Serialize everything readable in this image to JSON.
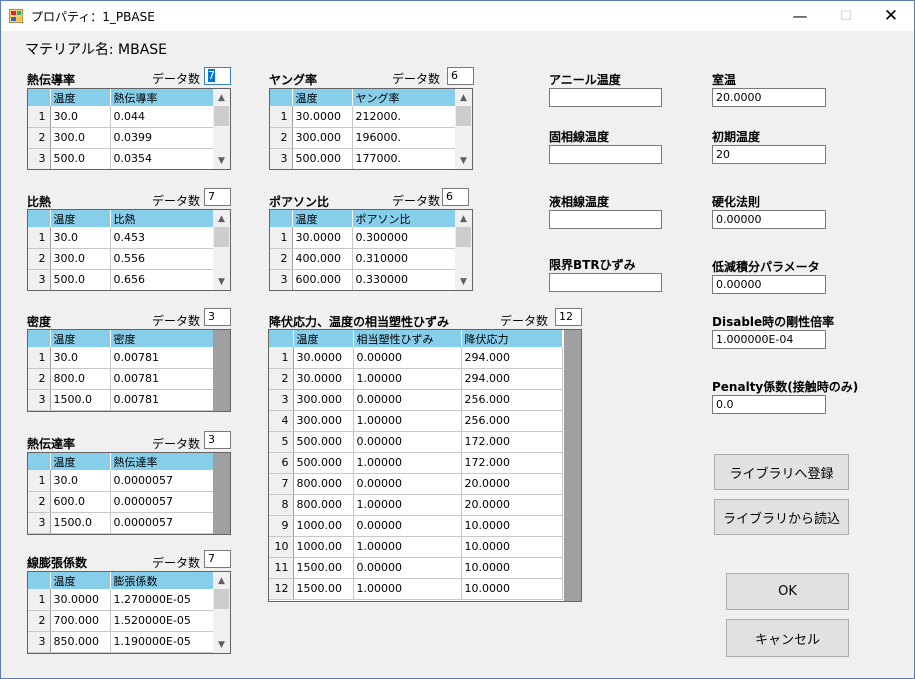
{
  "window": {
    "title": "プロパティ：1_PBASE",
    "min": "—",
    "max": "☐",
    "close": "✕"
  },
  "material_label": "マテリアル名:  MBASE",
  "count_label": "データ数",
  "conductivity": {
    "title": "熱伝導率",
    "count": "7",
    "headers": [
      "",
      "温度",
      "熱伝導率"
    ],
    "rows": [
      [
        "1",
        "30.0",
        "0.044"
      ],
      [
        "2",
        "300.0",
        "0.0399"
      ],
      [
        "3",
        "500.0",
        "0.0354"
      ]
    ]
  },
  "specific_heat": {
    "title": "比熱",
    "count": "7",
    "headers": [
      "",
      "温度",
      "比熱"
    ],
    "rows": [
      [
        "1",
        "30.0",
        "0.453"
      ],
      [
        "2",
        "300.0",
        "0.556"
      ],
      [
        "3",
        "500.0",
        "0.656"
      ]
    ]
  },
  "density": {
    "title": "密度",
    "count": "3",
    "headers": [
      "",
      "温度",
      "密度"
    ],
    "rows": [
      [
        "1",
        "30.0",
        "0.00781"
      ],
      [
        "2",
        "800.0",
        "0.00781"
      ],
      [
        "3",
        "1500.0",
        "0.00781"
      ]
    ]
  },
  "heat_transfer": {
    "title": "熱伝達率",
    "count": "3",
    "headers": [
      "",
      "温度",
      "熱伝達率"
    ],
    "rows": [
      [
        "1",
        "30.0",
        "0.0000057"
      ],
      [
        "2",
        "600.0",
        "0.0000057"
      ],
      [
        "3",
        "1500.0",
        "0.0000057"
      ]
    ]
  },
  "expansion": {
    "title": "線膨張係数",
    "count": "7",
    "headers": [
      "",
      "温度",
      "膨張係数"
    ],
    "rows": [
      [
        "1",
        "30.0000",
        "1.270000E-05"
      ],
      [
        "2",
        "700.000",
        "1.520000E-05"
      ],
      [
        "3",
        "850.000",
        "1.190000E-05"
      ]
    ]
  },
  "young": {
    "title": "ヤング率",
    "count": "6",
    "headers": [
      "",
      "温度",
      "ヤング率"
    ],
    "rows": [
      [
        "1",
        "30.0000",
        "212000."
      ],
      [
        "2",
        "300.000",
        "196000."
      ],
      [
        "3",
        "500.000",
        "177000."
      ]
    ]
  },
  "poisson": {
    "title": "ポアソン比",
    "count": "6",
    "headers": [
      "",
      "温度",
      "ポアソン比"
    ],
    "rows": [
      [
        "1",
        "30.0000",
        "0.300000"
      ],
      [
        "2",
        "400.000",
        "0.310000"
      ],
      [
        "3",
        "600.000",
        "0.330000"
      ]
    ]
  },
  "yield": {
    "title": "降伏応力、温度の相当塑性ひずみ",
    "count": "12",
    "headers": [
      "",
      "温度",
      "相当塑性ひずみ",
      "降伏応力"
    ],
    "rows": [
      [
        "1",
        "30.0000",
        "0.00000",
        "294.000"
      ],
      [
        "2",
        "30.0000",
        "1.00000",
        "294.000"
      ],
      [
        "3",
        "300.000",
        "0.00000",
        "256.000"
      ],
      [
        "4",
        "300.000",
        "1.00000",
        "256.000"
      ],
      [
        "5",
        "500.000",
        "0.00000",
        "172.000"
      ],
      [
        "6",
        "500.000",
        "1.00000",
        "172.000"
      ],
      [
        "7",
        "800.000",
        "0.00000",
        "20.0000"
      ],
      [
        "8",
        "800.000",
        "1.00000",
        "20.0000"
      ],
      [
        "9",
        "1000.00",
        "0.00000",
        "10.0000"
      ],
      [
        "10",
        "1000.00",
        "1.00000",
        "10.0000"
      ],
      [
        "11",
        "1500.00",
        "0.00000",
        "10.0000"
      ],
      [
        "12",
        "1500.00",
        "1.00000",
        "10.0000"
      ]
    ]
  },
  "temps": {
    "anneal_label": "アニール温度",
    "anneal_value": "",
    "solidus_label": "固相線温度",
    "solidus_value": "",
    "liquidus_label": "液相線温度",
    "liquidus_value": "",
    "btr_label": "限界BTRひずみ",
    "btr_value": ""
  },
  "right": {
    "room_label": "室温",
    "room_value": "20.0000",
    "initial_label": "初期温度",
    "initial_value": "20",
    "hardening_label": "硬化法則",
    "hardening_value": "0.00000",
    "reduced_label": "低減積分パラメータ",
    "reduced_value": "0.00000",
    "disable_label": "Disable時の剛性倍率",
    "disable_value": "1.000000E-04",
    "penalty_label": "Penalty係数(接触時のみ)",
    "penalty_value": "0.0"
  },
  "buttons": {
    "register": "ライブラリへ登録",
    "load": "ライブラリから読込",
    "ok": "OK",
    "cancel": "キャンセル"
  },
  "colors": {
    "header": "#87ceeb",
    "selection": "#0078d7"
  }
}
